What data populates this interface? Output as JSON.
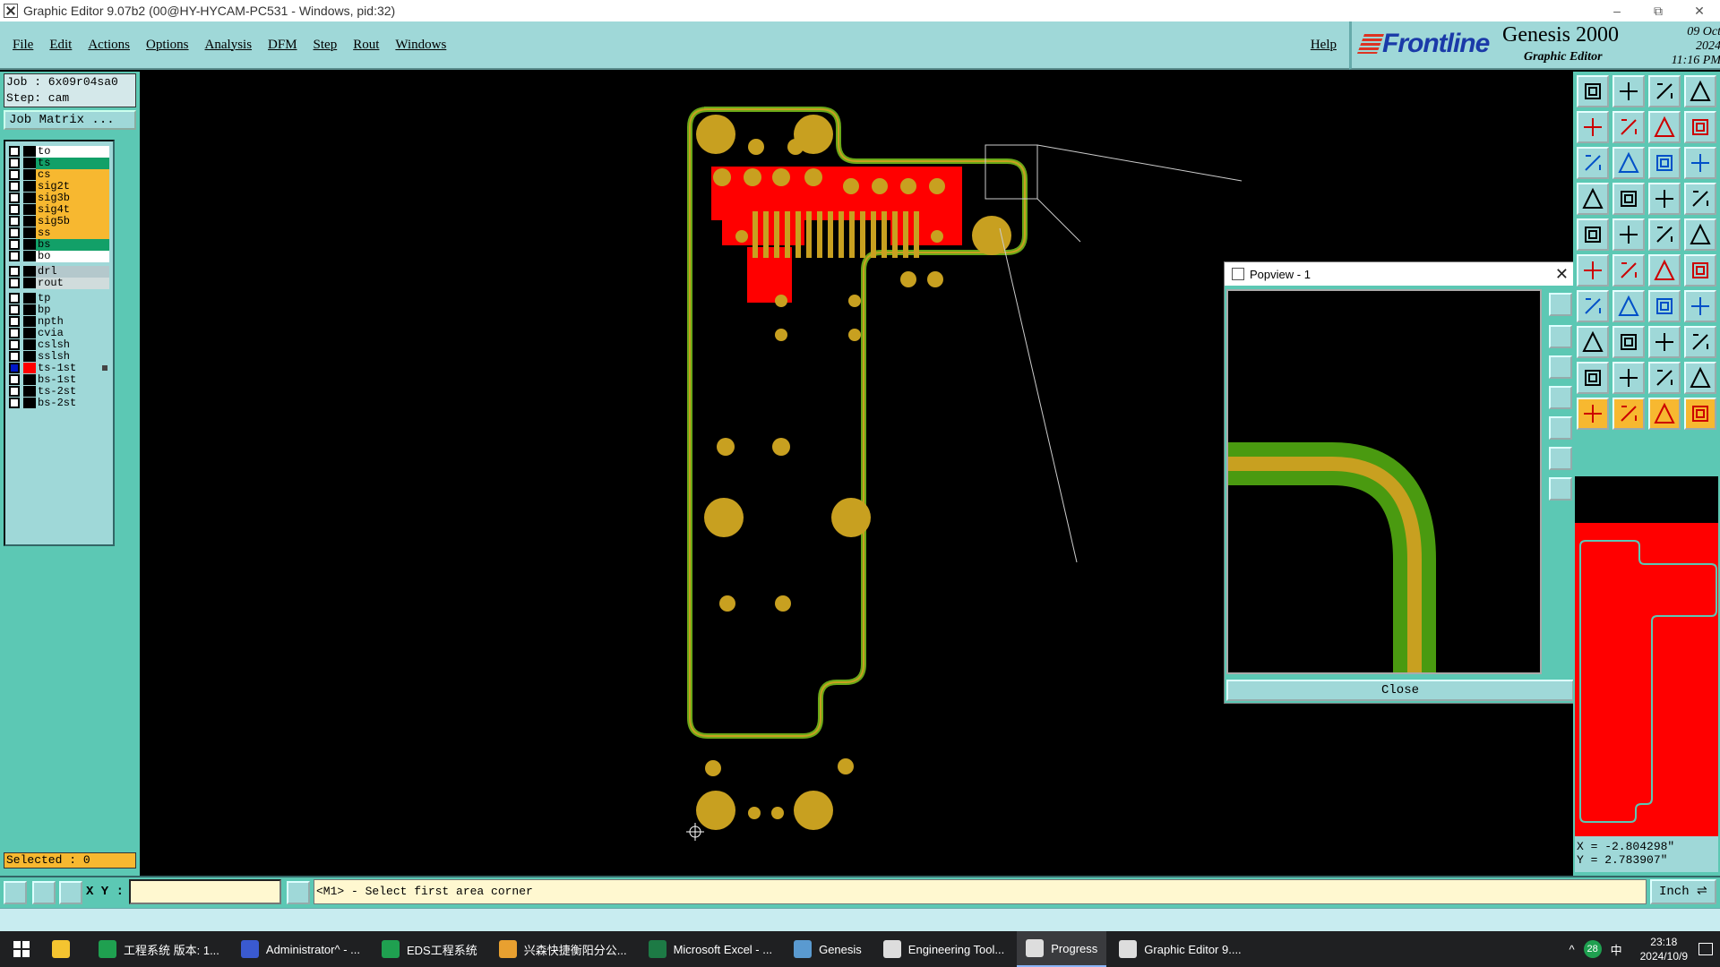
{
  "window": {
    "title": "Graphic Editor 9.07b2 (00@HY-HYCAM-PC531 - Windows, pid:32)",
    "controls": [
      "–",
      "⧉",
      "✕"
    ]
  },
  "menu": {
    "items": [
      "File",
      "Edit",
      "Actions",
      "Options",
      "Analysis",
      "DFM",
      "Step",
      "Rout",
      "Windows"
    ],
    "help": "Help"
  },
  "brand": {
    "logo": "Frontline",
    "product": "Genesis 2000",
    "subtitle": "Graphic Editor",
    "date": "09 Oct 2024",
    "time": "11:16 PM"
  },
  "job": {
    "job_line": "Job : 6x09r04sa0",
    "step_line": "Step: cam",
    "matrix_button": "Job Matrix ..."
  },
  "layers": [
    {
      "name": "to",
      "color": "#ffffff",
      "active": false
    },
    {
      "name": "ts",
      "color": "#12a068",
      "active": false
    },
    {
      "name": "cs",
      "color": "#f7b830",
      "active": false
    },
    {
      "name": "sig2t",
      "color": "#f7b830",
      "active": false
    },
    {
      "name": "sig3b",
      "color": "#f7b830",
      "active": false
    },
    {
      "name": "sig4t",
      "color": "#f7b830",
      "active": false
    },
    {
      "name": "sig5b",
      "color": "#f7b830",
      "active": false
    },
    {
      "name": "ss",
      "color": "#f7b830",
      "active": false
    },
    {
      "name": "bs",
      "color": "#12a068",
      "active": false
    },
    {
      "name": "bo",
      "color": "#ffffff",
      "active": false
    },
    {
      "name": "drl",
      "color": "#b4c8cc",
      "active": false
    },
    {
      "name": "rout",
      "color": "#d0dcdc",
      "active": false
    },
    {
      "name": "tp",
      "color": "#9fd8d8",
      "active": false
    },
    {
      "name": "bp",
      "color": "#9fd8d8",
      "active": false
    },
    {
      "name": "npth",
      "color": "#9fd8d8",
      "active": false
    },
    {
      "name": "cvia",
      "color": "#9fd8d8",
      "active": false
    },
    {
      "name": "cslsh",
      "color": "#9fd8d8",
      "active": false
    },
    {
      "name": "sslsh",
      "color": "#9fd8d8",
      "active": false
    },
    {
      "name": "ts-1st",
      "color": "#9fd8d8",
      "active": true
    },
    {
      "name": "bs-1st",
      "color": "#9fd8d8",
      "active": false
    },
    {
      "name": "ts-2st",
      "color": "#9fd8d8",
      "active": false
    },
    {
      "name": "bs-2st",
      "color": "#9fd8d8",
      "active": false
    }
  ],
  "selected": "Selected : 0",
  "popview": {
    "title": "Popview - 1",
    "close_label": "Close"
  },
  "coords": {
    "x": "X = -2.804298\"",
    "y": "Y = 2.783907\""
  },
  "bottom": {
    "xy_label": "X Y :",
    "xy_value": "",
    "message": "<M1> - Select first area corner",
    "unit": "Inch"
  },
  "taskbar": {
    "items": [
      {
        "label": "工程系统  版本: 1...",
        "icon_color": "#1fa050"
      },
      {
        "label": "Administrator^ - ...",
        "icon_color": "#3a5ad0"
      },
      {
        "label": "EDS工程系统",
        "icon_color": "#1fa050"
      },
      {
        "label": "兴森快捷衡阳分公...",
        "icon_color": "#e8a030"
      },
      {
        "label": "Microsoft Excel - ...",
        "icon_color": "#1d7a45"
      },
      {
        "label": "Genesis",
        "icon_color": "#5a9ad0"
      },
      {
        "label": "Engineering Tool...",
        "icon_color": "#dddddd"
      },
      {
        "label": "Progress",
        "icon_color": "#dddddd"
      },
      {
        "label": "Graphic Editor 9....",
        "icon_color": "#dddddd"
      }
    ],
    "tray_badge": "28",
    "ime": "中",
    "clock_time": "23:18",
    "clock_date": "2024/10/9"
  },
  "colors": {
    "panel": "#5cc8b4",
    "menu": "#9fd8d8",
    "copper": "#c8a020",
    "mask": "#ff0000",
    "outline": "#6aa818"
  }
}
